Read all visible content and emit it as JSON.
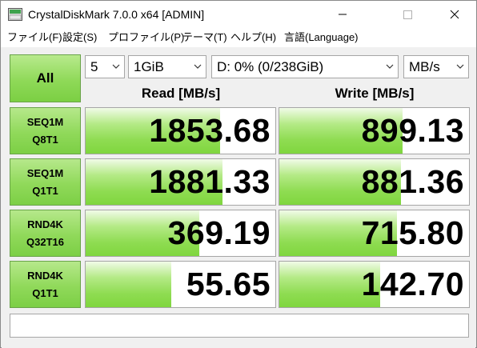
{
  "window": {
    "title": "CrystalDiskMark 7.0.0 x64 [ADMIN]",
    "icon": "crystaldiskmark-app-icon"
  },
  "menu": [
    {
      "label": "ファイル(F)"
    },
    {
      "label": "設定(S)"
    },
    {
      "label": "プロファイル(P)"
    },
    {
      "label": "テーマ(T)"
    },
    {
      "label": "ヘルプ(H)"
    },
    {
      "label": "言語(Language)"
    }
  ],
  "controls": {
    "all_label": "All",
    "count": "5",
    "size": "1GiB",
    "drive": "D: 0% (0/238GiB)",
    "unit": "MB/s"
  },
  "headers": {
    "read": "Read [MB/s]",
    "write": "Write [MB/s]"
  },
  "rows": [
    {
      "line1": "SEQ1M",
      "line2": "Q8T1",
      "read": "1853.68",
      "write": "899.13",
      "read_fill": 0.71,
      "write_fill": 0.65
    },
    {
      "line1": "SEQ1M",
      "line2": "Q1T1",
      "read": "1881.33",
      "write": "881.36",
      "read_fill": 0.72,
      "write_fill": 0.64
    },
    {
      "line1": "RND4K",
      "line2": "Q32T16",
      "read": "369.19",
      "write": "715.80",
      "read_fill": 0.6,
      "write_fill": 0.62
    },
    {
      "line1": "RND4K",
      "line2": "Q1T1",
      "read": "55.65",
      "write": "142.70",
      "read_fill": 0.45,
      "write_fill": 0.53
    }
  ],
  "comment": "",
  "colors": {
    "accent_green": "#8fd958",
    "border": "#a6a6a6",
    "panel": "#f0f0f0"
  }
}
